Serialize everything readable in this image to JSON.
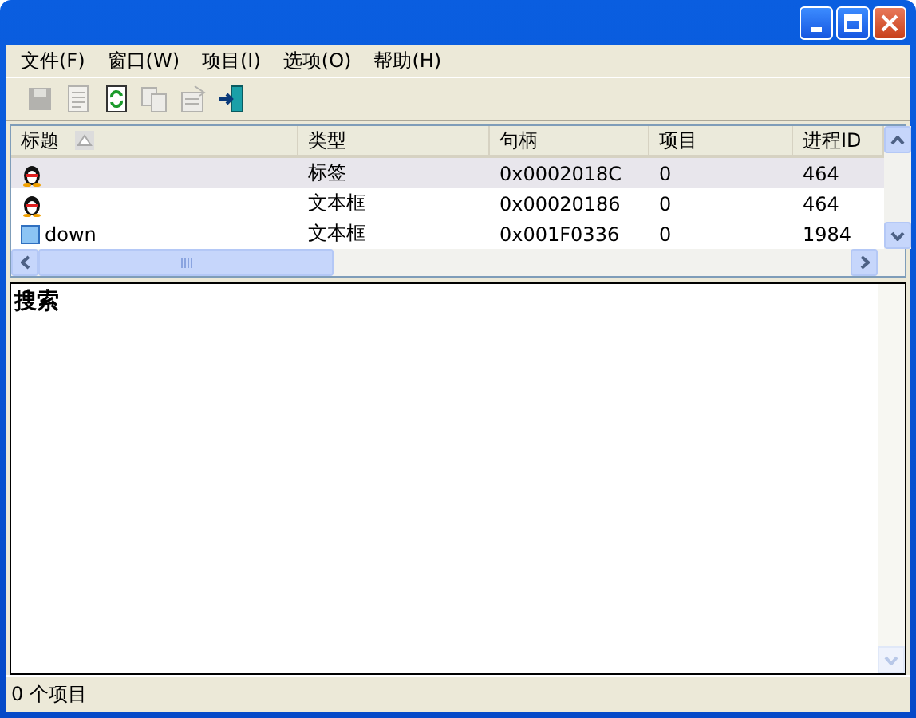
{
  "menu": [
    "文件(F)",
    "窗口(W)",
    "项目(I)",
    "选项(O)",
    "帮助(H)"
  ],
  "toolbar": [
    {
      "kind": "save",
      "disabled": true
    },
    {
      "kind": "page",
      "disabled": true
    },
    {
      "kind": "refresh",
      "disabled": false
    },
    {
      "kind": "copy",
      "disabled": true
    },
    {
      "kind": "properties",
      "disabled": true
    },
    {
      "kind": "exit",
      "disabled": false
    }
  ],
  "table": {
    "columns": [
      "标题",
      "类型",
      "句柄",
      "项目",
      "进程ID"
    ],
    "rows": [
      {
        "kind": "penguin",
        "selected": true,
        "cells": [
          "",
          "标签",
          "0x0002018C",
          "0",
          "464"
        ]
      },
      {
        "kind": "penguin",
        "selected": false,
        "cells": [
          "",
          "文本框",
          "0x00020186",
          "0",
          "464"
        ]
      },
      {
        "kind": "window",
        "selected": false,
        "cells": [
          "down",
          "文本框",
          "0x001F0336",
          "0",
          "1984"
        ]
      }
    ]
  },
  "search": {
    "label": "搜索"
  },
  "status_bar": "0 个项目"
}
